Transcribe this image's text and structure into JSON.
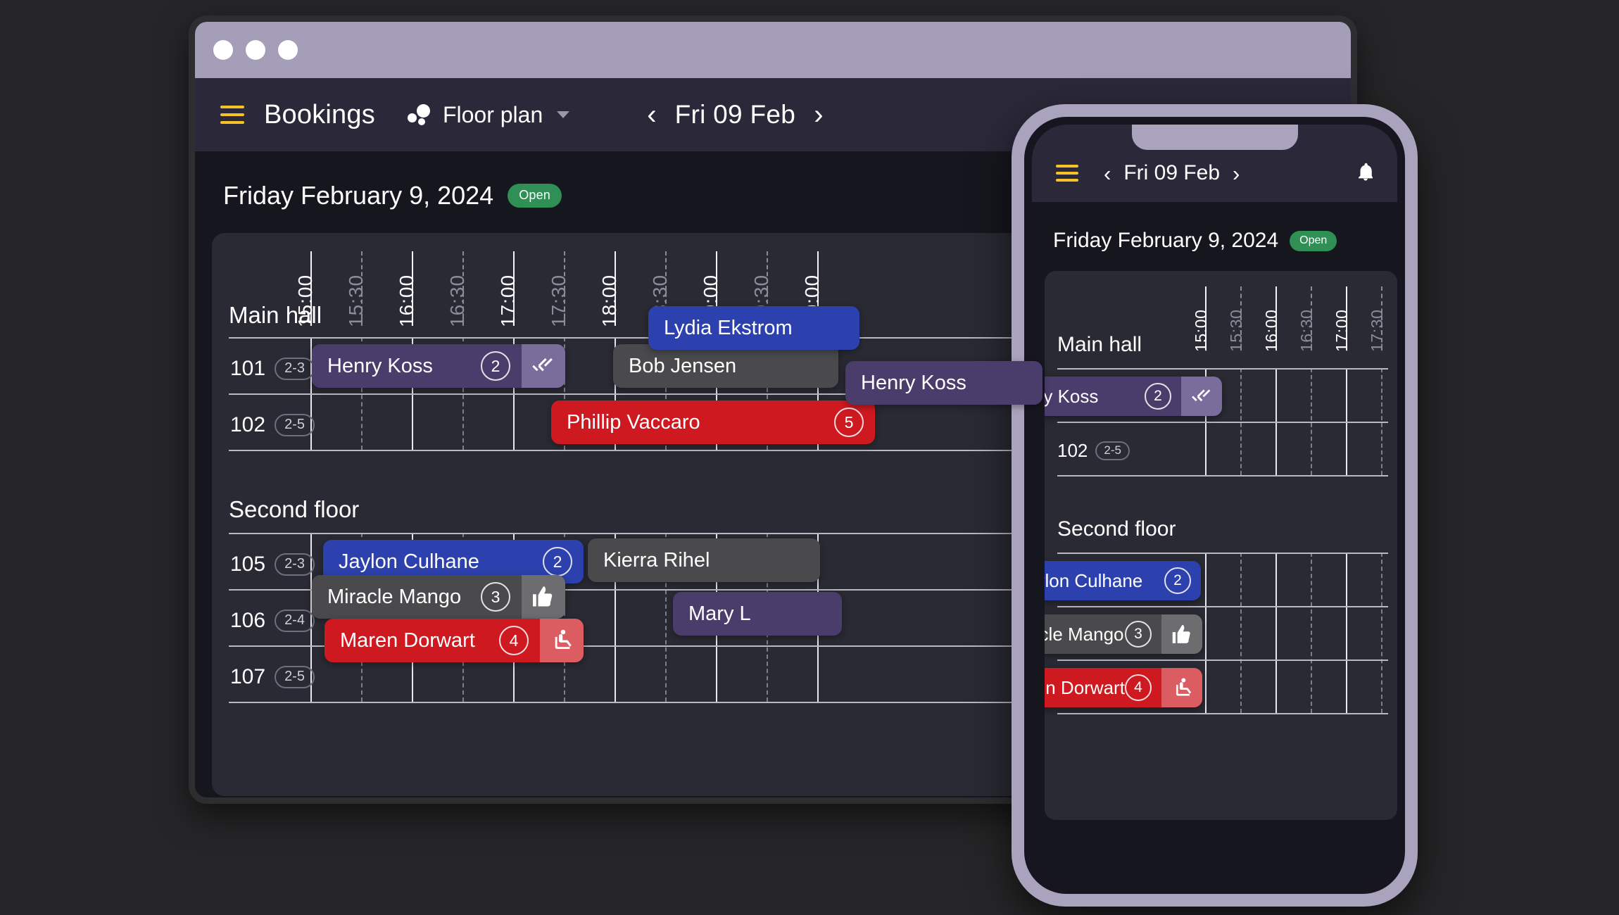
{
  "app": {
    "window_controls": [
      "close",
      "minimize",
      "maximize"
    ],
    "menu_icon": "hamburger-icon",
    "title": "Bookings",
    "view_selector": {
      "icon": "floor-plan-icon",
      "label": "Floor plan",
      "caret": "chevron-down-icon"
    },
    "date_nav": {
      "prev": "‹",
      "label": "Fri 09 Feb",
      "next": "›"
    }
  },
  "page": {
    "heading": "Friday February 9, 2024",
    "status_badge": "Open"
  },
  "timeline": {
    "desktop_ticks": [
      {
        "label": "15:00",
        "type": "hour"
      },
      {
        "label": "15:30",
        "type": "half"
      },
      {
        "label": "16:00",
        "type": "hour"
      },
      {
        "label": "16:30",
        "type": "half"
      },
      {
        "label": "17:00",
        "type": "hour"
      },
      {
        "label": "17:30",
        "type": "half"
      },
      {
        "label": "18:00",
        "type": "hour"
      },
      {
        "label": "18:30",
        "type": "half"
      },
      {
        "label": "19:00",
        "type": "hour"
      },
      {
        "label": "19:30",
        "type": "half"
      },
      {
        "label": "20:00",
        "type": "hour"
      }
    ],
    "phone_ticks": [
      {
        "label": "15:00",
        "type": "hour"
      },
      {
        "label": "15:30",
        "type": "half"
      },
      {
        "label": "16:00",
        "type": "hour"
      },
      {
        "label": "16:30",
        "type": "half"
      },
      {
        "label": "17:00",
        "type": "hour"
      },
      {
        "label": "17:30",
        "type": "half"
      }
    ]
  },
  "groups": [
    {
      "name": "Main hall",
      "rooms": [
        {
          "number": "101",
          "capacity": "2-3"
        },
        {
          "number": "102",
          "capacity": "2-5"
        }
      ]
    },
    {
      "name": "Second floor",
      "rooms": [
        {
          "number": "105",
          "capacity": "2-3"
        },
        {
          "number": "106",
          "capacity": "2-4"
        },
        {
          "number": "107",
          "capacity": "2-5"
        }
      ]
    }
  ],
  "bookings": [
    {
      "name": "Lydia Ekstrom",
      "pax": "",
      "color": "blue",
      "action_icon": ""
    },
    {
      "name": "Henry Koss",
      "pax": "2",
      "color": "purple",
      "action_icon": "double-check-icon"
    },
    {
      "name": "Bob Jensen",
      "pax": "",
      "color": "gray",
      "action_icon": ""
    },
    {
      "name": "Henry Koss",
      "pax": "",
      "color": "purple",
      "action_icon": ""
    },
    {
      "name": "Phillip Vaccaro",
      "pax": "5",
      "color": "red",
      "action_icon": ""
    },
    {
      "name": "Jaylon Culhane",
      "pax": "2",
      "color": "blue",
      "action_icon": ""
    },
    {
      "name": "Kierra Rihel",
      "pax": "",
      "color": "gray",
      "action_icon": ""
    },
    {
      "name": "Miracle Mango",
      "pax": "3",
      "color": "gray",
      "action_icon": "thumbs-up-icon"
    },
    {
      "name": "Mary L",
      "pax": "",
      "color": "purple",
      "action_icon": ""
    },
    {
      "name": "Maren Dorwart",
      "pax": "4",
      "color": "red",
      "action_icon": "seated-person-icon"
    }
  ],
  "phone": {
    "menu_icon": "hamburger-icon",
    "date_nav": {
      "prev": "‹",
      "label": "Fri 09 Feb",
      "next": "›"
    },
    "bell_icon": "bell-icon",
    "heading": "Friday February 9, 2024",
    "status_badge": "Open",
    "bookings": [
      {
        "name": "Henry Koss",
        "pax": "2",
        "color": "purple",
        "action_icon": "double-check-icon"
      },
      {
        "name": "Jaylon Culhane",
        "pax": "2",
        "color": "blue",
        "action_icon": ""
      },
      {
        "name": "Miracle Mango",
        "pax": "3",
        "color": "gray",
        "action_icon": "thumbs-up-icon"
      },
      {
        "name": "Maren Dorwart",
        "pax": "4",
        "color": "red",
        "action_icon": "seated-person-icon"
      }
    ]
  },
  "colors": {
    "page_bg": "#16161e",
    "card_bg": "#2a2a34",
    "topbar_bg": "#2b2839",
    "accent_yellow": "#f5c228",
    "badge_green": "#2f8f55",
    "bar_purple": "#4b3d6b",
    "bar_blue": "#2c41ad",
    "bar_gray": "#4a4a4d",
    "bar_red": "#ce1920",
    "phone_bezel": "#aaa3bd",
    "browser_titlebar": "#a49eb8"
  }
}
